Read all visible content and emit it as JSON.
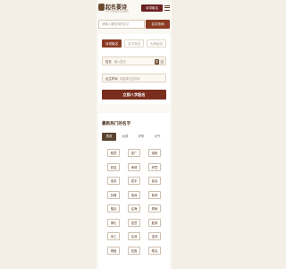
{
  "header": {
    "logo_title": "起名要诗",
    "logo_sub": "名字诗意美好宝宝起名",
    "action_button": "诗词取名",
    "menu_icon": "menu-icon"
  },
  "search": {
    "placeholder": "请输入要查询的名字",
    "button": "名字查询"
  },
  "form": {
    "tabs": [
      {
        "label": "诗词取名",
        "active": true
      },
      {
        "label": "名字测试",
        "active": false
      },
      {
        "label": "大师起名",
        "active": false
      }
    ],
    "surname_label": "姓氏",
    "surname_placeholder": "输入姓氏",
    "sex_male": "男",
    "sex_female": "女",
    "birth_label": "出生时间",
    "birth_placeholder": "请选择出生时间",
    "submit": "立即八字起名"
  },
  "hot": {
    "title": "最新热门的名字",
    "tabs": [
      {
        "label": "男孩",
        "active": true
      },
      {
        "label": "女孩",
        "active": false
      },
      {
        "label": "好听",
        "active": false
      },
      {
        "label": "大气",
        "active": false
      }
    ],
    "names": [
      "皓萱",
      "墨广",
      "瑞阳",
      "亚铭",
      "承晴",
      "梓萱",
      "浩岚",
      "墨宇",
      "景泓",
      "凯峰",
      "浩泽",
      "紫煦",
      "楷泓",
      "泓海",
      "希雨",
      "博礼",
      "墨萱",
      "胜祺",
      "米乙",
      "泓泽",
      "浩鸿",
      "博鑫",
      "宏鑫",
      "皓泓"
    ]
  }
}
